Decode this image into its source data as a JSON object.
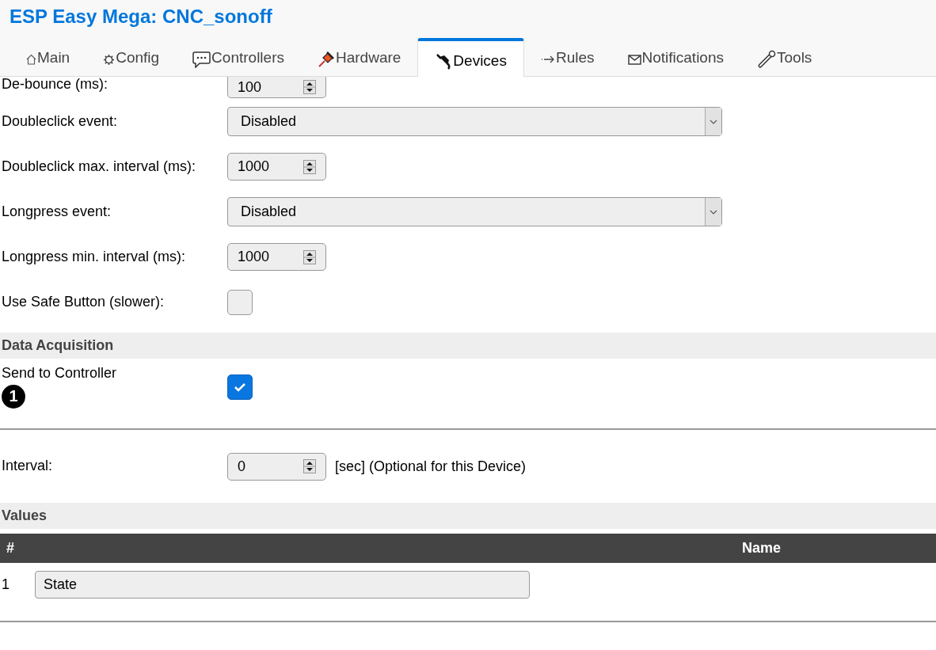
{
  "title": "ESP Easy Mega: CNC_sonoff",
  "tabs": [
    {
      "label": "Main",
      "selected": false
    },
    {
      "label": "Config",
      "selected": false
    },
    {
      "label": "Controllers",
      "selected": false
    },
    {
      "label": "Hardware",
      "selected": false
    },
    {
      "label": "Devices",
      "selected": true
    },
    {
      "label": "Rules",
      "selected": false
    },
    {
      "label": "Notifications",
      "selected": false
    },
    {
      "label": "Tools",
      "selected": false
    }
  ],
  "settings": [
    {
      "kind": "number",
      "label": "De-bounce (ms):",
      "value": "100"
    },
    {
      "kind": "select",
      "label": "Doubleclick event:",
      "value": "Disabled"
    },
    {
      "kind": "number",
      "label": "Doubleclick max. interval (ms):",
      "value": "1000"
    },
    {
      "kind": "select",
      "label": "Longpress event:",
      "value": "Disabled"
    },
    {
      "kind": "number",
      "label": "Longpress min. interval (ms):",
      "value": "1000"
    },
    {
      "kind": "checkbox",
      "label": "Use Safe Button (slower):",
      "checked": false
    }
  ],
  "data_acquisition": {
    "heading": "Data Acquisition",
    "send_label": "Send to Controller",
    "controller_badge": "1",
    "send_checked": true,
    "interval_label": "Interval:",
    "interval_value": "0",
    "interval_note": "[sec] (Optional for this Device)"
  },
  "values": {
    "heading": "Values",
    "columns": [
      "#",
      "Name"
    ],
    "rows": [
      {
        "index": "1",
        "name": "State"
      }
    ]
  }
}
